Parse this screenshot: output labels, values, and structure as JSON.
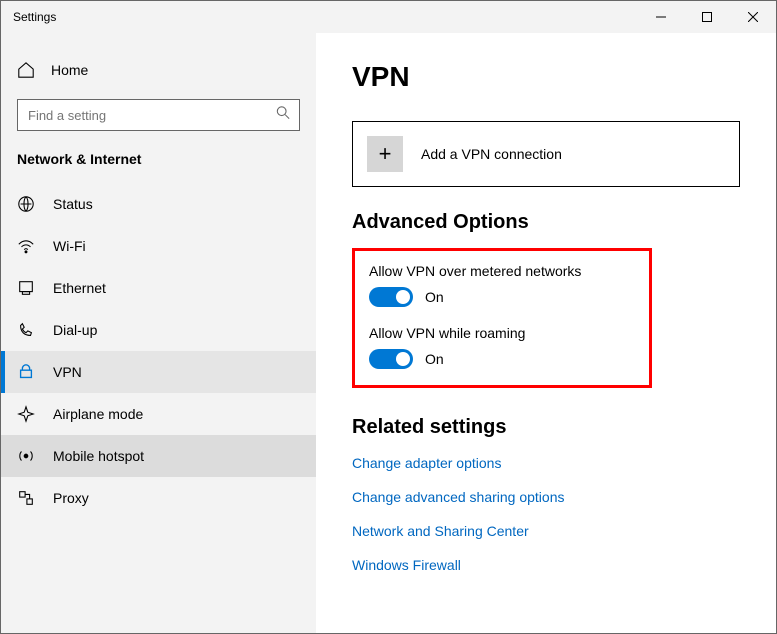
{
  "titlebar": {
    "title": "Settings"
  },
  "sidebar": {
    "home_label": "Home",
    "search_placeholder": "Find a setting",
    "heading": "Network & Internet",
    "items": [
      {
        "label": "Status"
      },
      {
        "label": "Wi-Fi"
      },
      {
        "label": "Ethernet"
      },
      {
        "label": "Dial-up"
      },
      {
        "label": "VPN"
      },
      {
        "label": "Airplane mode"
      },
      {
        "label": "Mobile hotspot"
      },
      {
        "label": "Proxy"
      }
    ]
  },
  "content": {
    "page_title": "VPN",
    "add_vpn_label": "Add a VPN connection",
    "advanced_heading": "Advanced Options",
    "toggle1": {
      "label": "Allow VPN over metered networks",
      "state": "On"
    },
    "toggle2": {
      "label": "Allow VPN while roaming",
      "state": "On"
    },
    "related_heading": "Related settings",
    "links": [
      "Change adapter options",
      "Change advanced sharing options",
      "Network and Sharing Center",
      "Windows Firewall"
    ]
  }
}
